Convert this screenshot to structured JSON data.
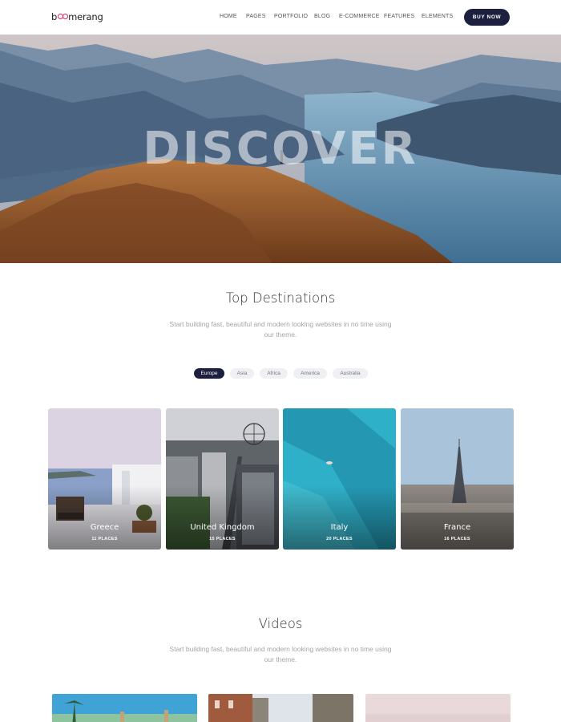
{
  "header": {
    "logo": {
      "prefix": "b",
      "suffix": "merang"
    },
    "nav": [
      "HOME",
      "PAGES",
      "PORTFOLIO",
      "BLOG",
      "E-COMMERCE",
      "FEATURES",
      "ELEMENTS"
    ],
    "buy_button": "BUY NOW"
  },
  "hero": {
    "title": "DISCOVER"
  },
  "destinations": {
    "title": "Top Destinations",
    "subtitle": "Start building fast, beautiful and modern looking websites in no time using our theme.",
    "filters": [
      "Europe",
      "Asia",
      "Africa",
      "America",
      "Australia"
    ],
    "active_filter": "Europe",
    "cards": [
      {
        "name": "Greece",
        "places": "11 PLACES"
      },
      {
        "name": "United Kingdom",
        "places": "15 PLACES"
      },
      {
        "name": "Italy",
        "places": "20 PLACES"
      },
      {
        "name": "France",
        "places": "16 PLACES"
      }
    ]
  },
  "videos": {
    "title": "Videos",
    "subtitle": "Start building fast, beautiful and modern looking websites in no time using our theme."
  },
  "colors": {
    "brand_dark": "#1c1f3d",
    "logo_accent": "#e0245e"
  }
}
